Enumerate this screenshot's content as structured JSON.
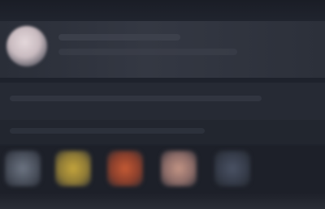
{
  "app": {
    "theme": "dark",
    "background_color": "#1e222c",
    "note_text": ""
  },
  "header": {
    "title": ""
  },
  "profile": {
    "avatar_icon": "user-avatar",
    "name": "",
    "subtitle": ""
  },
  "content": {
    "line_1": "",
    "line_2": ""
  },
  "icon_row": {
    "items": [
      {
        "icon": "grey-app-icon",
        "color": "#6c7482",
        "label": ""
      },
      {
        "icon": "yellow-app-icon",
        "color": "#c4a43c",
        "label": ""
      },
      {
        "icon": "orange-app-icon",
        "color": "#c55a34",
        "label": ""
      },
      {
        "icon": "pink-app-icon",
        "color": "#c39484",
        "label": ""
      },
      {
        "icon": "slate-app-icon",
        "color": "#4a5264",
        "label": ""
      }
    ]
  }
}
